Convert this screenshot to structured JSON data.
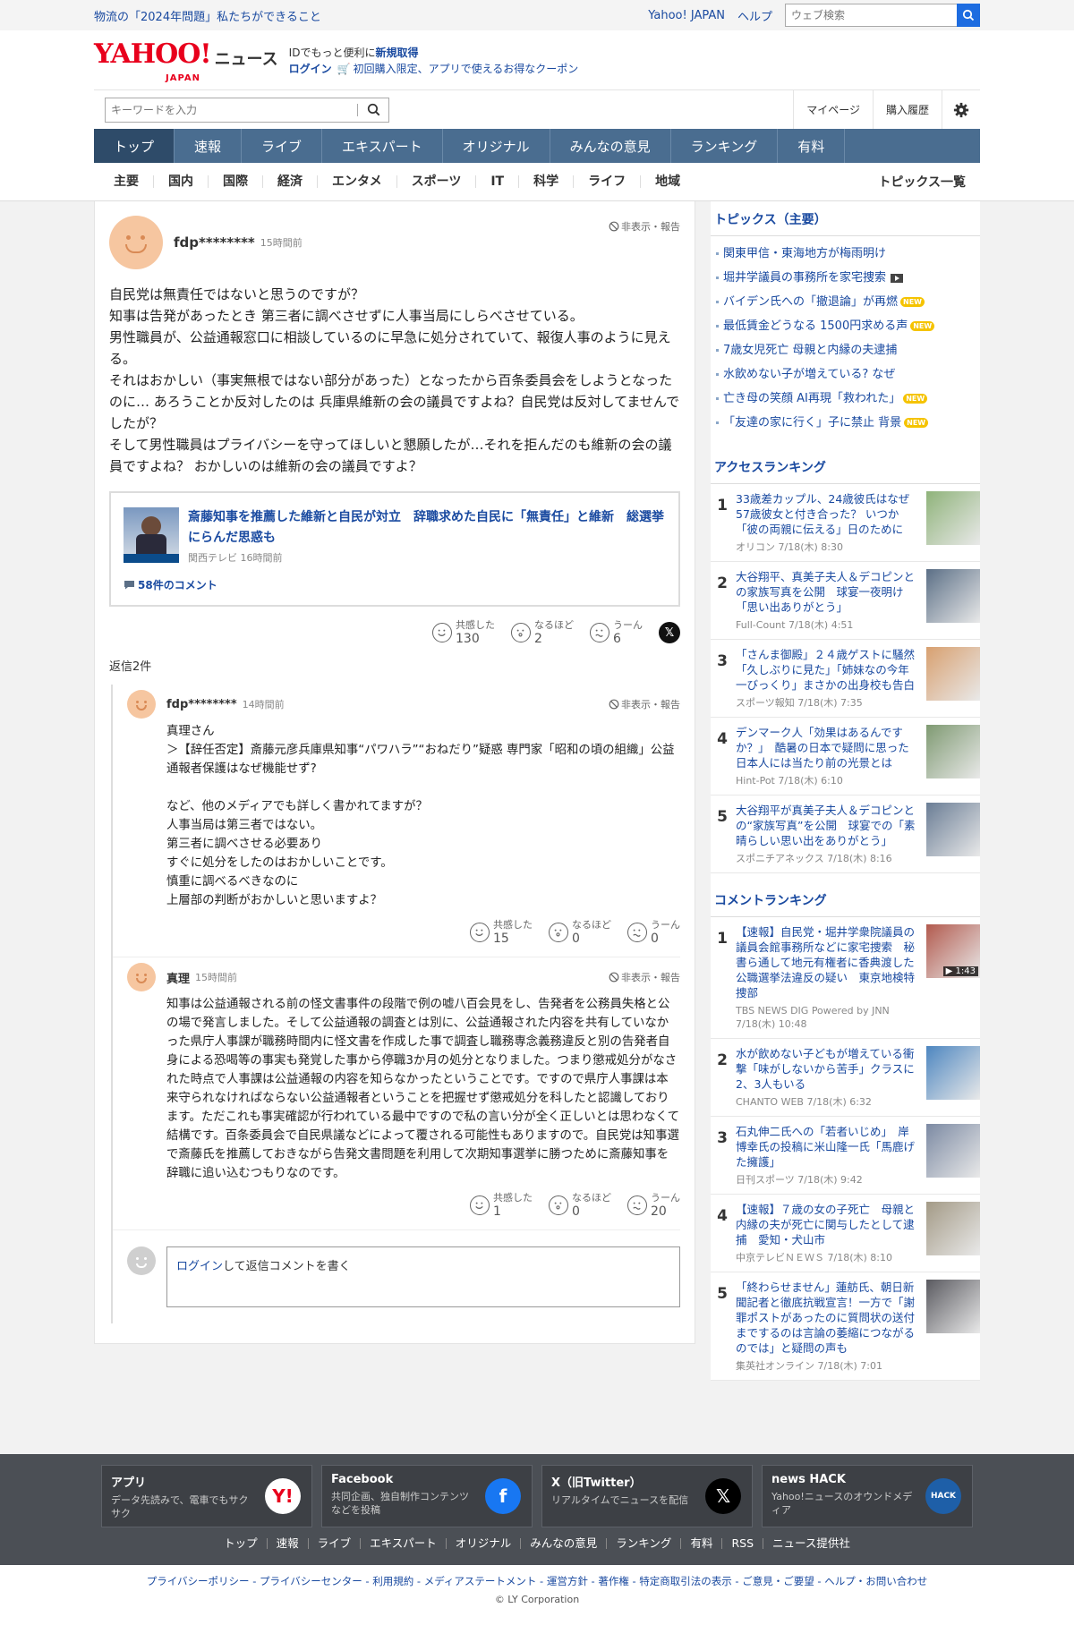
{
  "topbar": {
    "promo": "物流の「2024年問題」私たちができること",
    "yahoo_japan": "Yahoo! JAPAN",
    "help": "ヘルプ",
    "web_search_placeholder": "ウェブ検索"
  },
  "header": {
    "logo_yahoo": "YAHOO!",
    "logo_japan": "JAPAN",
    "logo_news": "ニュース",
    "id_line_prefix": "IDでもっと便利に",
    "id_line_link": "新規取得",
    "login": "ログイン",
    "coupon": "初回購入限定、アプリで使えるお得なクーポン"
  },
  "search": {
    "placeholder": "キーワードを入力",
    "mypage": "マイページ",
    "history": "購入履歴"
  },
  "mainnav": [
    "トップ",
    "速報",
    "ライブ",
    "エキスパート",
    "オリジナル",
    "みんなの意見",
    "ランキング",
    "有料"
  ],
  "subnav": [
    "主要",
    "国内",
    "国際",
    "経済",
    "エンタメ",
    "スポーツ",
    "IT",
    "科学",
    "ライフ",
    "地域"
  ],
  "topics_all": "トピックス一覧",
  "comment": {
    "user": "fdp********",
    "time": "15時間前",
    "report": "非表示・報告",
    "body": "自民党は無責任ではないと思うのですが？\n知事は告発があったとき 第三者に調べさせずに人事当局にしらべさせている。\n男性職員が、公益通報窓口に相談しているのに早急に処分されていて、報復人事のように見える。\nそれはおかしい（事実無根ではない部分があった）となったから百条委員会をしようとなったのに… あろうことか反対したのは 兵庫県維新の会の議員ですよね？自民党は反対してませんでしたが？\nそして男性職員はプライバシーを守ってほしいと懇願したが…それを拒んだのも維新の会の議員ですよね？ おかしいのは維新の会の議員ですよ？",
    "article": {
      "title": "斎藤知事を推薦した維新と自民が対立　辞職求めた自民に「無責任」と維新　総選挙にらんだ思惑も",
      "meta": "関西テレビ 16時間前",
      "comments": "58件のコメント"
    },
    "reactions": [
      {
        "label": "共感した",
        "count": "130"
      },
      {
        "label": "なるほど",
        "count": "2"
      },
      {
        "label": "うーん",
        "count": "6"
      }
    ],
    "x_label": "𝕏",
    "replies_label": "返信2件"
  },
  "replies": [
    {
      "user": "fdp********",
      "time": "14時間前",
      "report": "非表示・報告",
      "body": "真理さん\n＞【辞任否定】斎藤元彦兵庫県知事“パワハラ”“おねだり”疑惑 専門家「昭和の頃の組織」公益通報者保護はなぜ機能せず?\n\nなど、他のメディアでも詳しく書かれてますが？\n人事当局は第三者ではない。\n第三者に調べさせる必要あり\nすぐに処分をしたのはおかしいことです。\n慎重に調べるべきなのに\n上層部の判断がおかしいと思いますよ？",
      "reactions": [
        {
          "label": "共感した",
          "count": "15"
        },
        {
          "label": "なるほど",
          "count": "0"
        },
        {
          "label": "うーん",
          "count": "0"
        }
      ]
    },
    {
      "user": "真理",
      "time": "15時間前",
      "report": "非表示・報告",
      "body": "知事は公益通報される前の怪文書事件の段階で例の嘘八百会見をし、告発者を公務員失格と公の場で発言しました。そして公益通報の調査とは別に、公益通報された内容を共有していなかった県庁人事課が職務時間内に怪文書を作成した事で調査し職務専念義務違反と別の告発者自身による恐喝等の事実も発覚した事から停職3か月の処分となりました。つまり懲戒処分がなされた時点で人事課は公益通報の内容を知らなかったということです。ですので県庁人事課は本来守られなければならない公益通報者ということを把握せず懲戒処分を科したと認識しております。ただこれも事実確認が行われている最中ですので私の言い分が全く正しいとは思わなくて結構です。百条委員会で自民県議などによって覆される可能性もありますので。自民党は知事選で斎藤氏を推薦しておきながら告発文書問題を利用して次期知事選挙に勝つために斎藤知事を辞職に追い込むつもりなのです。",
      "reactions": [
        {
          "label": "共感した",
          "count": "1"
        },
        {
          "label": "なるほど",
          "count": "0"
        },
        {
          "label": "うーん",
          "count": "20"
        }
      ]
    }
  ],
  "reply_write": {
    "link": "ログイン",
    "rest": "して返信コメントを書く"
  },
  "sidebar": {
    "topics_title": "トピックス（主要）",
    "topics": [
      {
        "text": "関東甲信・東海地方が梅雨明け",
        "badge": ""
      },
      {
        "text": "堀井学議員の事務所を家宅捜索",
        "badge": "video"
      },
      {
        "text": "バイデン氏への「撤退論」が再燃",
        "badge": "NEW"
      },
      {
        "text": "最低賃金どうなる 1500円求める声",
        "badge": "NEW"
      },
      {
        "text": "7歳女児死亡 母親と内縁の夫逮捕",
        "badge": ""
      },
      {
        "text": "水飲めない子が増えている? なぜ",
        "badge": ""
      },
      {
        "text": "亡き母の笑顔 AI再現「救われた」",
        "badge": "NEW"
      },
      {
        "text": "「友達の家に行く」子に禁止 背景",
        "badge": "NEW"
      }
    ],
    "access_title": "アクセスランキング",
    "access": [
      {
        "n": "1",
        "title": "33歳差カップル、24歳彼氏はなぜ57歳彼女と付き合った？ いつか「彼の両親に伝える」日のために",
        "meta": "オリコン 7/18(木) 8:30",
        "color": "#8fb37a"
      },
      {
        "n": "2",
        "title": "大谷翔平、真美子夫人＆デコピンとの家族写真を公開　球宴一夜明け「思い出ありがとう」",
        "meta": "Full-Count 7/18(木) 4:51",
        "color": "#5b6f86"
      },
      {
        "n": "3",
        "title": "「さんま御殿」２４歳ゲストに騒然「久しぶりに見た」「姉妹なの今年一びっくり」まさかの出身校も告白",
        "meta": "スポーツ報知 7/18(木) 7:35",
        "color": "#d8a070"
      },
      {
        "n": "4",
        "title": "デンマーク人「効果はあるんですか？」　酷暑の日本で疑問に思った　日本人には当たり前の光景とは",
        "meta": "Hint-Pot 7/18(木) 6:10",
        "color": "#7f9a72"
      },
      {
        "n": "5",
        "title": "大谷翔平が真美子夫人＆デコピンとの“家族写真”を公開　球宴での「素晴らしい思い出をありがとう」",
        "meta": "スポニチアネックス 7/18(木) 8:16",
        "color": "#6a7d95"
      }
    ],
    "comment_title": "コメントランキング",
    "comment_rank": [
      {
        "n": "1",
        "title": "【速報】自民党・堀井学衆院議員の議員会館事務所などに家宅捜索　秘書ら通して地元有権者に香典渡した公職選挙法違反の疑い　東京地検特捜部",
        "meta": "TBS NEWS DIG Powered by JNN 7/18(木) 10:48",
        "color": "#b25a4e",
        "dur": "▶ 1:43"
      },
      {
        "n": "2",
        "title": "水が飲めない子どもが増えている衝撃「味がしないから苦手」クラスに2、3人もいる",
        "meta": "CHANTO WEB 7/18(木) 6:32",
        "color": "#4d86c0",
        "dur": ""
      },
      {
        "n": "3",
        "title": "石丸伸二氏への「若者いじめ」　岸博幸氏の投稿に米山隆一氏「馬鹿げた擁護」",
        "meta": "日刊スポーツ 7/18(木) 9:42",
        "color": "#7c8aa3",
        "dur": ""
      },
      {
        "n": "4",
        "title": "【速報】７歳の女の子死亡　母親と内縁の夫が死亡に関与したとして逮捕　愛知・犬山市",
        "meta": "中京テレビＮＥＷＳ 7/18(木) 8:10",
        "color": "#a39a86",
        "dur": ""
      },
      {
        "n": "5",
        "title": "「終わらせません」蓮舫氏、朝日新聞記者と徹底抗戦宣言！一方で「謝罪ポストがあったのに質問状の送付までするのは言論の萎縮につながるのでは」と疑問の声も",
        "meta": "集英社オンライン 7/18(木) 7:01",
        "color": "#5a5a60",
        "dur": ""
      }
    ]
  },
  "footer": {
    "cards": [
      {
        "title": "アプリ",
        "desc": "データ先読みで、電車でもサクサク",
        "icon": "yahoo-app-icon",
        "icon_text": "Y!",
        "bg": "#ffffff",
        "fg": "#e8001c"
      },
      {
        "title": "Facebook",
        "desc": "共同企画、独自制作コンテンツなどを投稿",
        "icon": "facebook-icon",
        "icon_text": "f",
        "bg": "#1877f2",
        "fg": "#ffffff"
      },
      {
        "title": "X（旧Twitter）",
        "desc": "リアルタイムでニュースを配信",
        "icon": "x-icon",
        "icon_text": "𝕏",
        "bg": "#000000",
        "fg": "#ffffff"
      },
      {
        "title": "news HACK",
        "desc": "Yahoo!ニュースのオウンドメディア",
        "icon": "newshack-icon",
        "icon_text": "HACK",
        "bg": "#1e5fa8",
        "fg": "#ffffff"
      }
    ],
    "links": [
      "トップ",
      "速報",
      "ライブ",
      "エキスパート",
      "オリジナル",
      "みんなの意見",
      "ランキング",
      "有料",
      "RSS",
      "ニュース提供社"
    ],
    "legal": "プライバシーポリシー - プライバシーセンター - 利用規約 - メディアステートメント - 運営方針 - 著作権 - 特定商取引法の表示 - ご意見・ご要望 - ヘルプ・お問い合わせ",
    "copyright": "© LY Corporation"
  }
}
